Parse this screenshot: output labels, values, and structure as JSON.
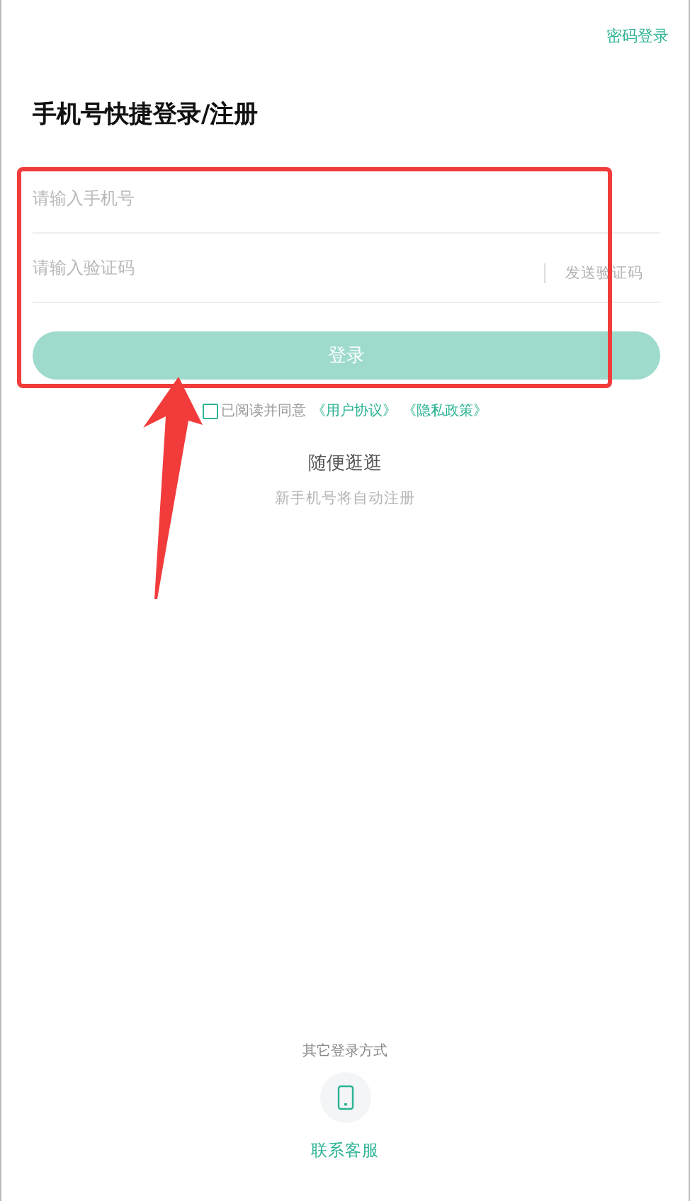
{
  "top_link": "密码登录",
  "title": "手机号快捷登录/注册",
  "phone_field": {
    "placeholder": "请输入手机号"
  },
  "code_field": {
    "placeholder": "请输入验证码"
  },
  "send_code": "发送验证码",
  "login_button": {
    "label": "登录",
    "disabled": true
  },
  "agreement": {
    "checked": false,
    "text": "已阅读并同意",
    "links": [
      "《用户协议》",
      "《隐私政策》"
    ]
  },
  "browse": {
    "label": "随便逛逛",
    "hint": "新手机号将自动注册"
  },
  "other_login": {
    "label": "其它登录方式"
  },
  "contact": "联系客服"
}
